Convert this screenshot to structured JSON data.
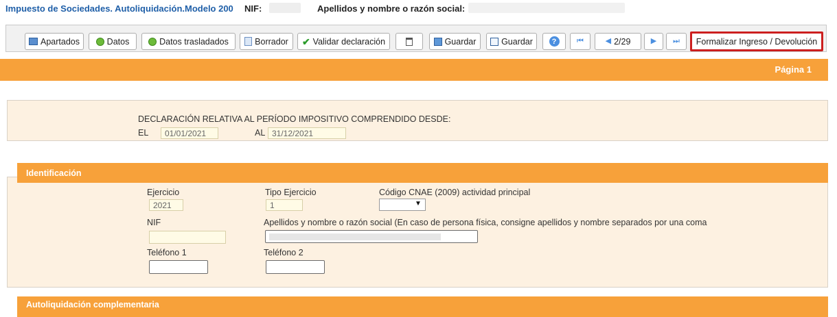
{
  "header": {
    "title": "Impuesto de Sociedades. Autoliquidación.Modelo 200",
    "nif_label": "NIF:",
    "name_label": "Apellidos y nombre o razón social:"
  },
  "toolbar": {
    "apartados": "Apartados",
    "datos": "Datos",
    "datos_trasladados": "Datos trasladados",
    "borrador": "Borrador",
    "validar": "Validar declaración",
    "guardar1": "Guardar",
    "guardar2": "Guardar",
    "page_indicator": "2/29",
    "formalizar": "Formalizar Ingreso / Devolución"
  },
  "page_bar": {
    "label": "Página 1"
  },
  "period": {
    "heading": "DECLARACIÓN RELATIVA AL PERÍODO IMPOSITIVO COMPRENDIDO DESDE:",
    "el_label": "EL",
    "el_value": "01/01/2021",
    "al_label": "AL",
    "al_value": "31/12/2021"
  },
  "identificacion": {
    "title": "Identificación",
    "ejercicio_label": "Ejercicio",
    "ejercicio_value": "2021",
    "tipo_label": "Tipo Ejercicio",
    "tipo_value": "1",
    "cnae_label": "Código CNAE (2009) actividad principal",
    "nif_label": "NIF",
    "razon_label": "Apellidos y nombre o razón social (En caso de persona física, consigne apellidos y nombre separados por una coma",
    "tel1_label": "Teléfono 1",
    "tel2_label": "Teléfono 2"
  },
  "complementaria": {
    "title": "Autoliquidación complementaria"
  },
  "colors": {
    "accent_orange": "#f7a13a",
    "panel_bg": "#fdf1e1",
    "title_blue": "#1f5fa8",
    "highlight_red": "#cc1f1f"
  },
  "icons": [
    "apartados-icon",
    "datos-icon",
    "datos-trasladados-icon",
    "borrador-icon",
    "check-icon",
    "trash-icon",
    "save-icon",
    "save-export-icon",
    "help-icon",
    "first-page-icon",
    "prev-page-icon",
    "next-page-icon",
    "last-page-icon",
    "dropdown-arrow-icon"
  ]
}
